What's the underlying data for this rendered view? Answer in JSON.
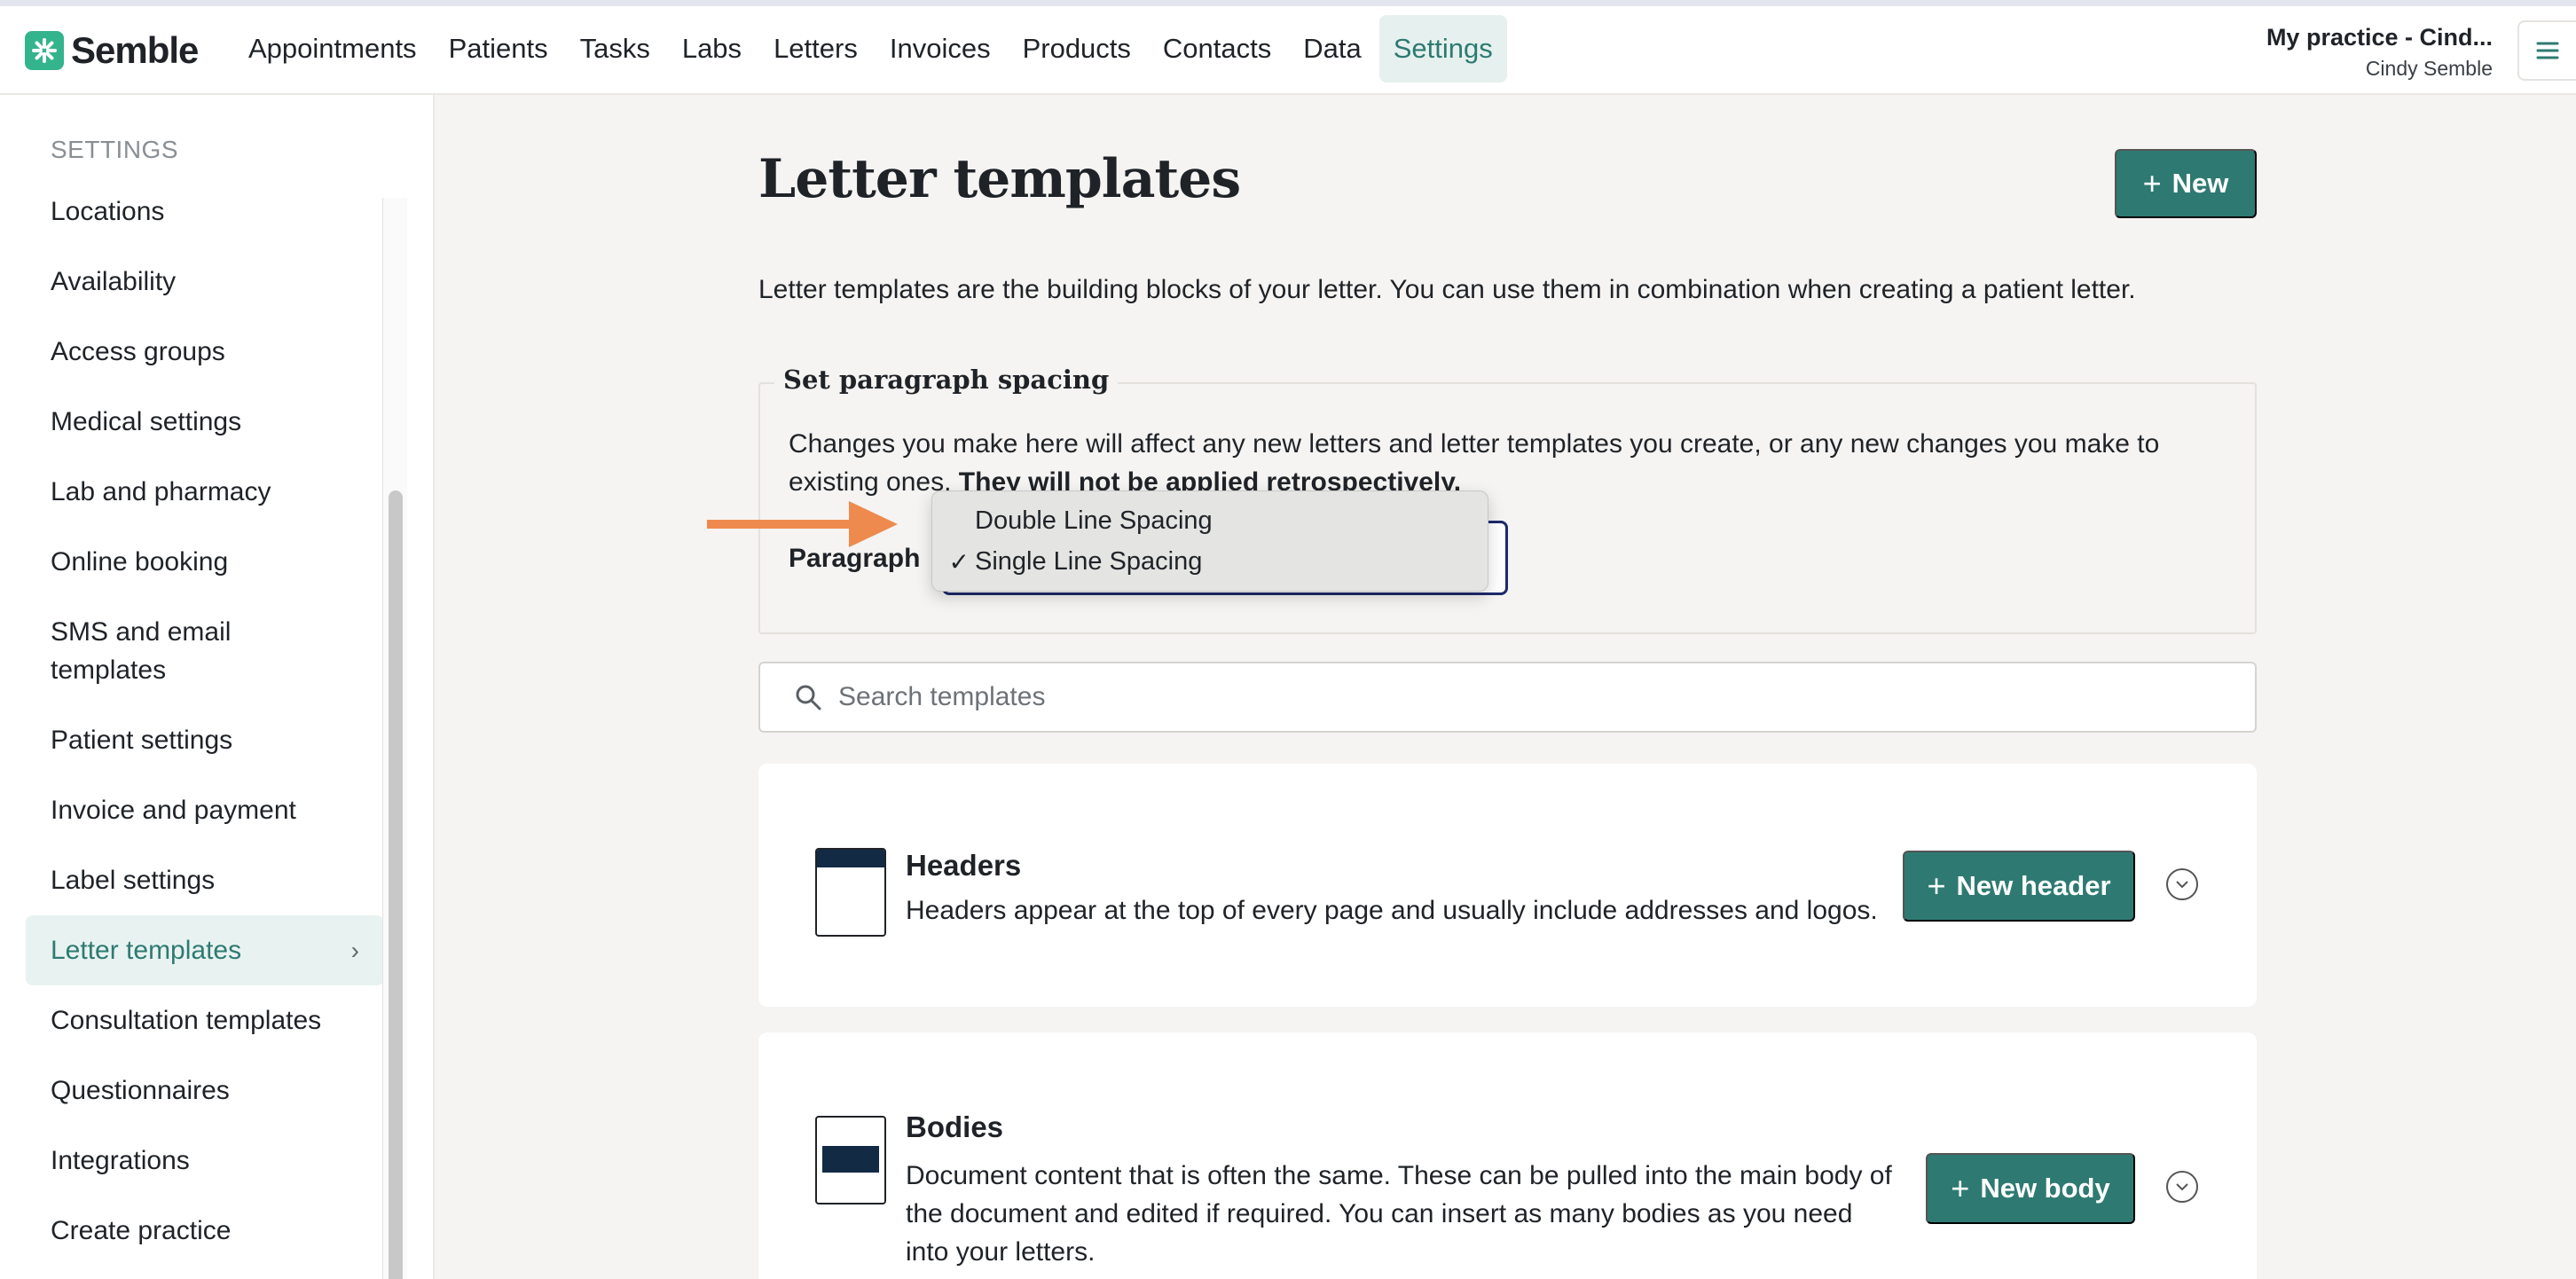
{
  "app": {
    "name": "Semble"
  },
  "nav": {
    "items": [
      {
        "label": "Appointments",
        "active": false
      },
      {
        "label": "Patients",
        "active": false
      },
      {
        "label": "Tasks",
        "active": false
      },
      {
        "label": "Labs",
        "active": false
      },
      {
        "label": "Letters",
        "active": false
      },
      {
        "label": "Invoices",
        "active": false
      },
      {
        "label": "Products",
        "active": false
      },
      {
        "label": "Contacts",
        "active": false
      },
      {
        "label": "Data",
        "active": false
      },
      {
        "label": "Settings",
        "active": true
      }
    ]
  },
  "practice": {
    "name": "My practice - Cind...",
    "user": "Cindy Semble"
  },
  "sidebar": {
    "heading": "SETTINGS",
    "items": [
      {
        "label": "Locations",
        "active": false
      },
      {
        "label": "Availability",
        "active": false
      },
      {
        "label": "Access groups",
        "active": false
      },
      {
        "label": "Medical settings",
        "active": false
      },
      {
        "label": "Lab and pharmacy",
        "active": false
      },
      {
        "label": "Online booking",
        "active": false
      },
      {
        "label": "SMS and email templates",
        "active": false
      },
      {
        "label": "Patient settings",
        "active": false
      },
      {
        "label": "Invoice and payment",
        "active": false
      },
      {
        "label": "Label settings",
        "active": false
      },
      {
        "label": "Letter templates",
        "active": true
      },
      {
        "label": "Consultation templates",
        "active": false
      },
      {
        "label": "Questionnaires",
        "active": false
      },
      {
        "label": "Integrations",
        "active": false
      },
      {
        "label": "Create practice",
        "active": false
      }
    ]
  },
  "main": {
    "title": "Letter templates",
    "new_button": "New",
    "intro": "Letter templates are the building blocks of your letter. You can use them in combination when creating a patient letter.",
    "spacing": {
      "legend": "Set paragraph spacing",
      "text": "Changes you make here will affect any new letters and letter templates you create, or any new changes you make to existing ones.",
      "text_bold": "They will not be applied retrospectively.",
      "label": "Paragraph",
      "options": [
        {
          "label": "Double Line Spacing",
          "selected": false
        },
        {
          "label": "Single Line Spacing",
          "selected": true
        }
      ],
      "check": "✓"
    },
    "search": {
      "placeholder": "Search templates"
    },
    "sections": {
      "headers": {
        "title": "Headers",
        "description": "Headers appear at the top of every page and usually include addresses and logos.",
        "button": "New header"
      },
      "bodies": {
        "title": "Bodies",
        "description": "Document content that is often the same. These can be pulled into the main body of the document and edited if required. You can insert as many bodies as you need into your letters.",
        "button": "New body"
      }
    }
  },
  "colors": {
    "accent": "#2e7a72",
    "annotation_arrow": "#ee8a4e",
    "logo": "#34b48c",
    "icon_fill": "#132a45"
  }
}
